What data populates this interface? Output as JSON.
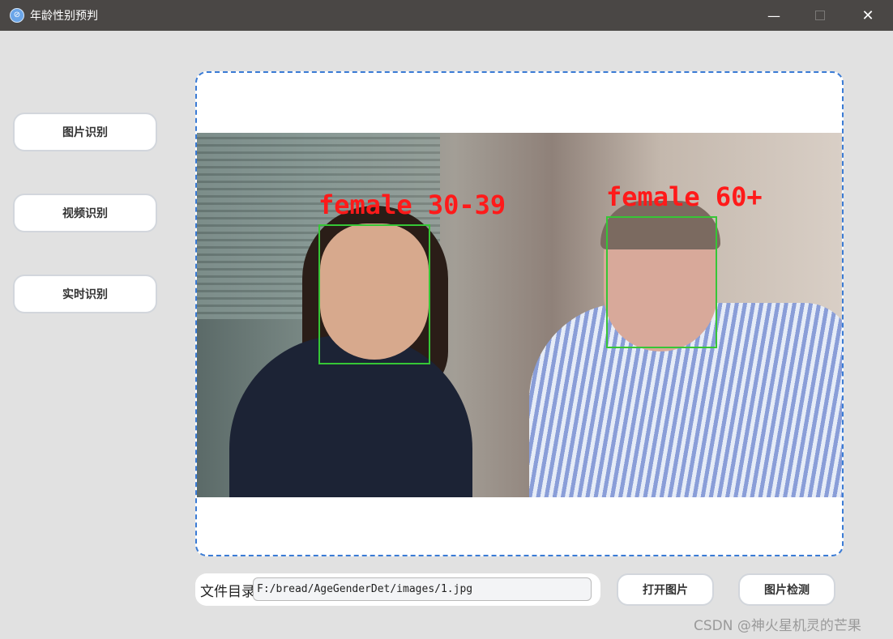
{
  "window": {
    "title": "年龄性别预判",
    "minimize_glyph": "—",
    "close_glyph": "✕"
  },
  "sidebar": {
    "items": [
      {
        "label": "图片识别"
      },
      {
        "label": "视频识别"
      },
      {
        "label": "实时识别"
      }
    ]
  },
  "display": {
    "detections": [
      {
        "label": "female 30-39"
      },
      {
        "label": "female 60+"
      }
    ]
  },
  "file": {
    "label": "文件目录",
    "path": "F:/bread/AgeGenderDet/images/1.jpg"
  },
  "actions": {
    "open_label": "打开图片",
    "detect_label": "图片检测"
  },
  "watermark": "CSDN @神火星机灵的芒果",
  "colors": {
    "titlebar": "#4a4745",
    "background": "#e1e1e1",
    "frame_border": "#3a7bd5",
    "box": "#36c636",
    "label": "#ff1a1a"
  },
  "icons": [
    "app-icon",
    "minimize-icon",
    "maximize-icon",
    "close-icon"
  ]
}
